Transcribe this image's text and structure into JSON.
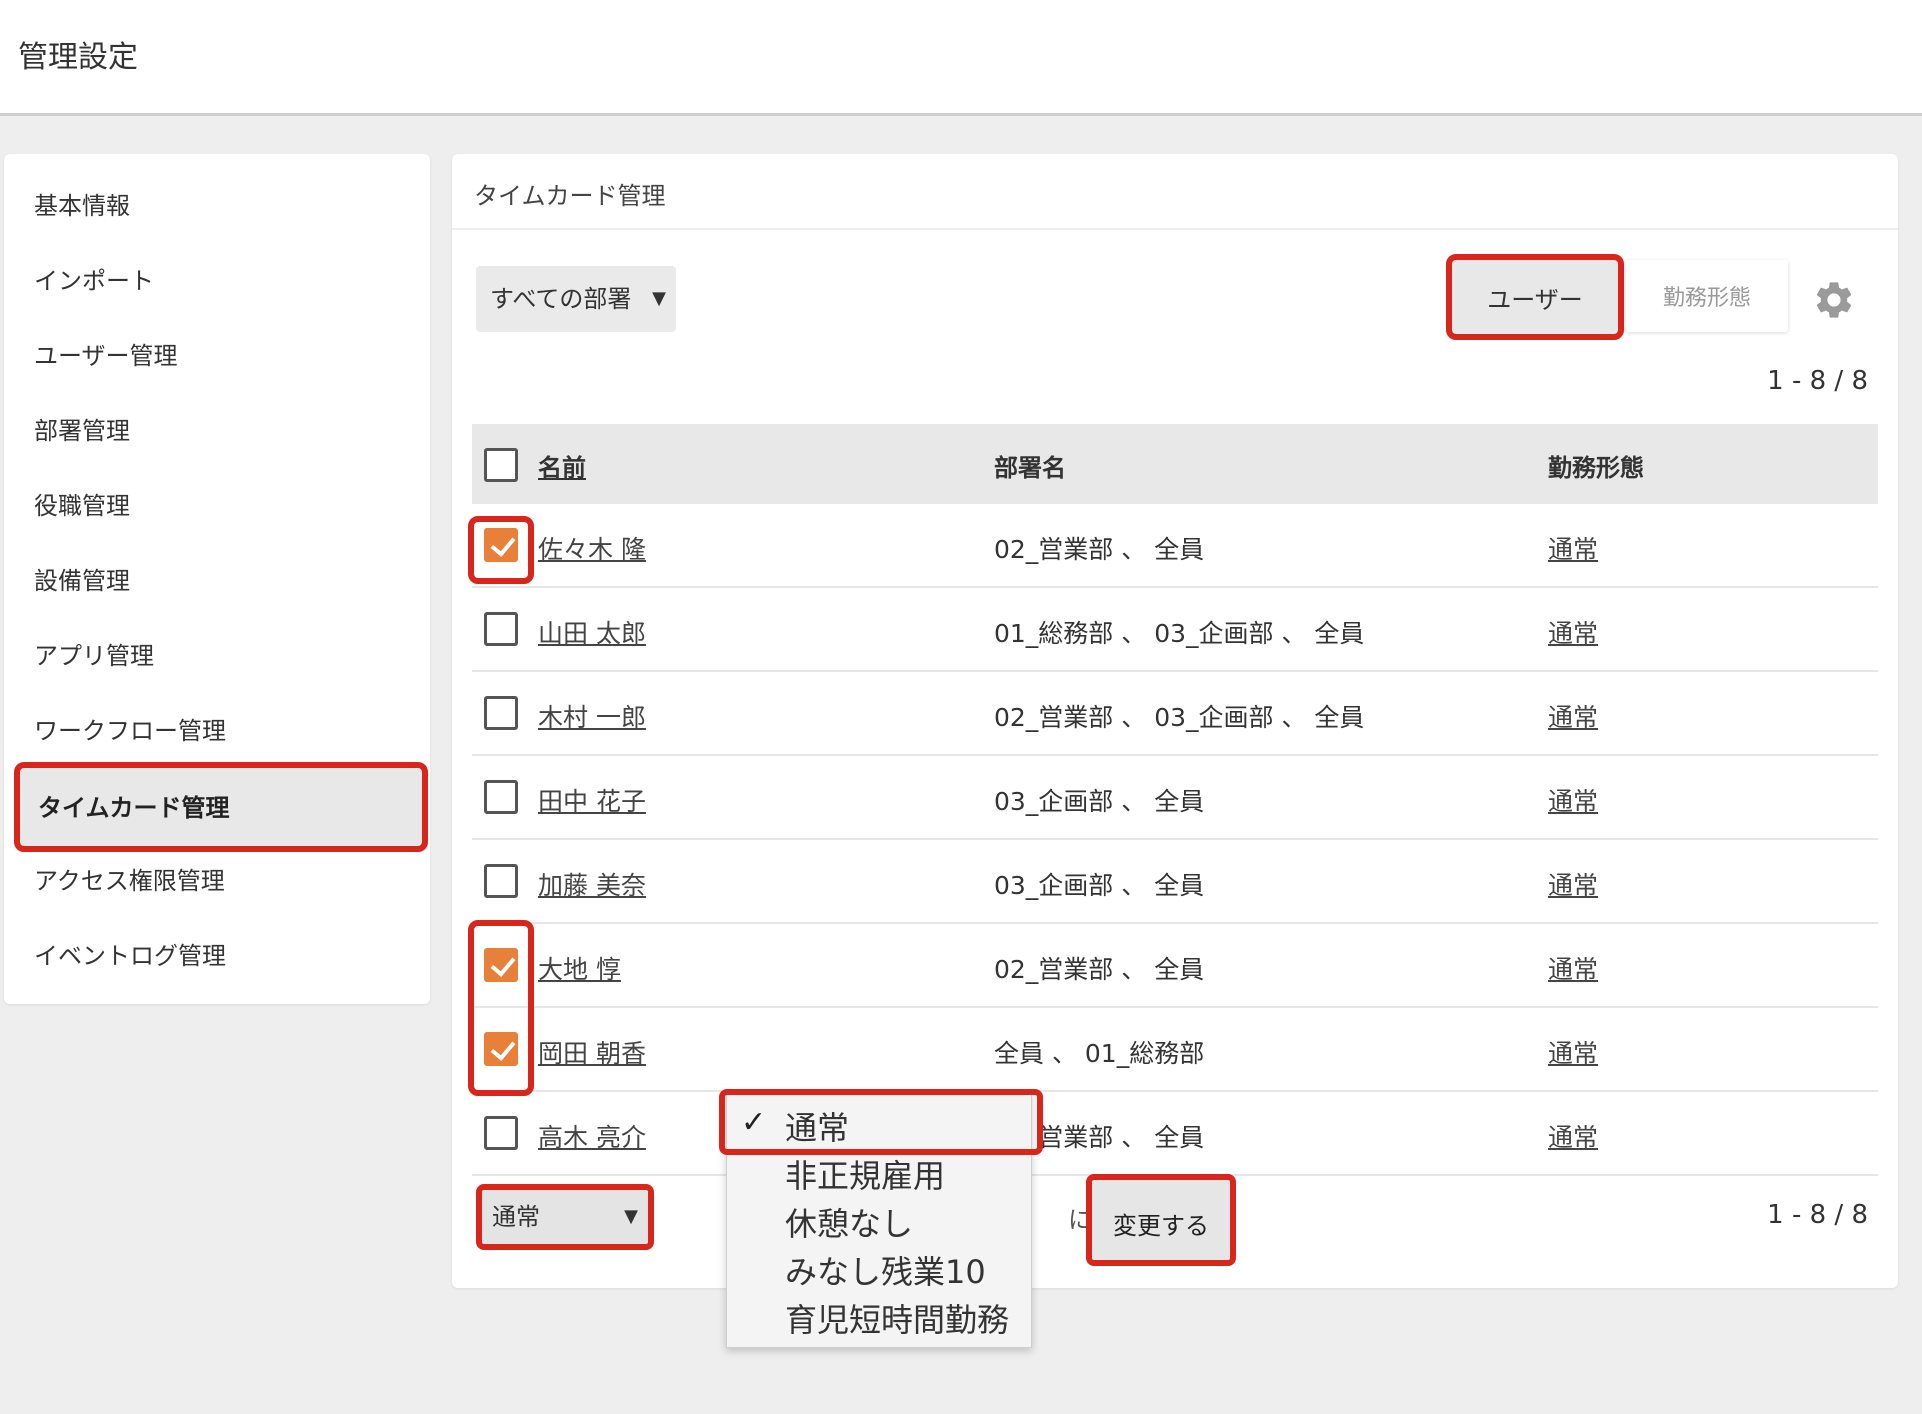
{
  "header": {
    "title": "管理設定"
  },
  "sidebar": {
    "items": [
      {
        "label": "基本情報"
      },
      {
        "label": "インポート"
      },
      {
        "label": "ユーザー管理"
      },
      {
        "label": "部署管理"
      },
      {
        "label": "役職管理"
      },
      {
        "label": "設備管理"
      },
      {
        "label": "アプリ管理"
      },
      {
        "label": "ワークフロー管理"
      },
      {
        "label": "タイムカード管理",
        "active": true
      },
      {
        "label": "アクセス権限管理"
      },
      {
        "label": "イベントログ管理"
      }
    ]
  },
  "main": {
    "title": "タイムカード管理",
    "dept_filter": "すべての部署",
    "tabs": {
      "user": "ユーザー",
      "shift": "勤務形態"
    },
    "pager_top": "1 - 8 / 8",
    "pager_bottom": "1 - 8 / 8",
    "table": {
      "headers": {
        "name": "名前",
        "dept": "部署名",
        "shift": "勤務形態"
      },
      "rows": [
        {
          "name": "佐々木 隆",
          "dept": "02_営業部 、 全員",
          "shift": "通常",
          "checked": true
        },
        {
          "name": "山田 太郎",
          "dept": "01_総務部 、 03_企画部 、 全員",
          "shift": "通常",
          "checked": false
        },
        {
          "name": "木村 一郎",
          "dept": "02_営業部 、 03_企画部 、 全員",
          "shift": "通常",
          "checked": false
        },
        {
          "name": "田中 花子",
          "dept": "03_企画部 、 全員",
          "shift": "通常",
          "checked": false
        },
        {
          "name": "加藤 美奈",
          "dept": "03_企画部 、 全員",
          "shift": "通常",
          "checked": false
        },
        {
          "name": "大地 惇",
          "dept": "02_営業部 、 全員",
          "shift": "通常",
          "checked": true
        },
        {
          "name": "岡田 朝香",
          "dept": "全員 、 01_総務部",
          "shift": "通常",
          "checked": true
        },
        {
          "name": "高木 亮介",
          "dept": "02_営業部 、 全員",
          "shift": "通常",
          "checked": false
        }
      ]
    },
    "bulk": {
      "selected_shift": "通常",
      "connector": "に",
      "change_label": "変更する",
      "options": [
        "通常",
        "非正規雇用",
        "休憩なし",
        "みなし残業10",
        "育児短時間勤務"
      ],
      "checkmark": "✓"
    }
  },
  "colors": {
    "highlight": "#d9261c",
    "checkbox": "#e8803a"
  },
  "icons": {
    "settings": "gear-icon",
    "dropdown": "chevron-down-icon"
  }
}
